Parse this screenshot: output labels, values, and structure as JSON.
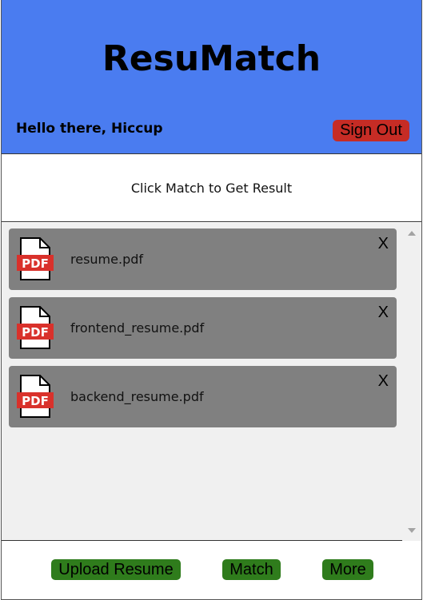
{
  "header": {
    "title": "ResuMatch",
    "greeting": "Hello there, Hiccup",
    "sign_out_label": "Sign Out"
  },
  "result": {
    "message": "Click Match to Get Result"
  },
  "files": [
    {
      "name": "resume.pdf",
      "icon": "pdf-icon",
      "close_label": "X"
    },
    {
      "name": "frontend_resume.pdf",
      "icon": "pdf-icon",
      "close_label": "X"
    },
    {
      "name": "backend_resume.pdf",
      "icon": "pdf-icon",
      "close_label": "X"
    }
  ],
  "pdf_icon_text": "PDF",
  "footer": {
    "upload_label": "Upload Resume",
    "match_label": "Match",
    "more_label": "More"
  },
  "colors": {
    "header_bg": "#4a7cf0",
    "sign_out_bg": "#c62c25",
    "action_button_bg": "#2f7c1c",
    "file_item_bg": "#808080",
    "pdf_red": "#d9312b"
  }
}
